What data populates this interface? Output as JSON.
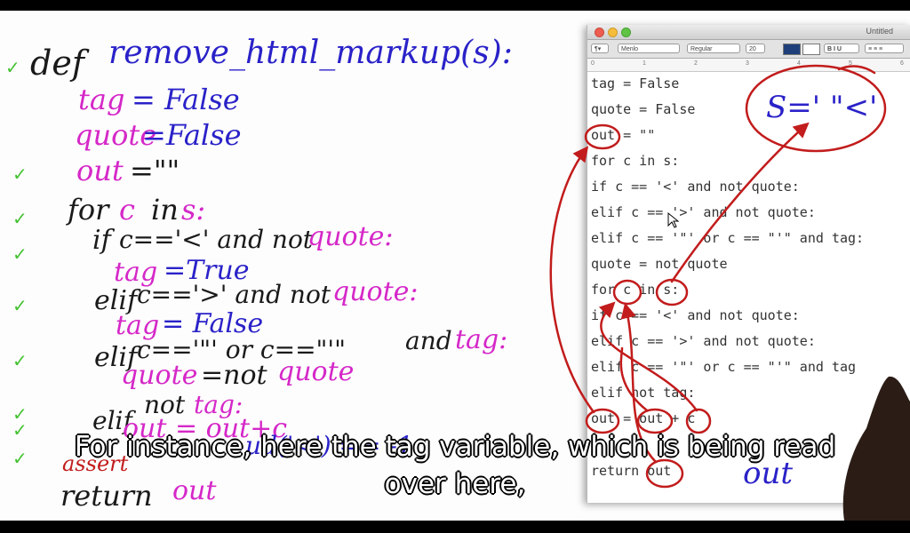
{
  "handwriting": {
    "def_kw": "def",
    "func_sig": "remove_html_markup(s):",
    "tag_name": "tag",
    "tag_init": "= False",
    "quote_name": "quote",
    "quote_init": "=False",
    "out_name": "out",
    "out_init": "=\"\"",
    "for_kw": "for",
    "for_var": "c",
    "for_in": "in",
    "for_iter": "s:",
    "if_kw": "if",
    "if_cond": "c=='<' and not",
    "if_quote": "quote:",
    "if_tag": "tag",
    "if_true": "=True",
    "elif1_kw": "elif",
    "elif1_cond": "c=='>' and not",
    "elif1_quote": "quote:",
    "elif1_tag": "tag",
    "elif1_false": "= False",
    "elif2_kw": "elif",
    "elif2_cond": "c=='\"' or c==\"'\"",
    "elif2_and": "and",
    "elif2_tag": "tag:",
    "quote_assign_a": "quote",
    "quote_assign_b": "=not",
    "quote_assign_c": "quote",
    "elif3_kw": "elif",
    "elif3_cond": "not",
    "elif3_tag": "tag:",
    "out_assign": "out = out+c",
    "assert_word": "assert",
    "return_kw": "return",
    "return_val": "out",
    "board_fragment": "ud('<') == -1",
    "s_note": "S=' \"<'",
    "out_note": "out"
  },
  "editor": {
    "window_title": "Untitled",
    "font_name": "Menlo",
    "font_style": "Regular",
    "font_size": "20",
    "ruler_marks": [
      "0",
      "1",
      "2",
      "3",
      "4",
      "5",
      "6"
    ],
    "code_lines": [
      "tag = False",
      "quote = False",
      "out = \"\"",
      "for c in s:",
      "if c == '<' and not quote:",
      "elif c == '>' and not quote:",
      "elif c == '\"' or c == \"'\" and tag:",
      "quote = not quote",
      "for c in s:",
      "if c == '<' and not quote:",
      "elif c == '>' and not quote:",
      "elif c == '\"' or c == \"'\" and tag",
      "elif not tag:",
      "out = out + c",
      "return out"
    ]
  },
  "subtitle": {
    "line1": "For instance, here the tag variable, which is being read",
    "line2": "over here,"
  },
  "colors": {
    "ink_black": "#1a1a1a",
    "ink_blue": "#2a22c8",
    "ink_pink": "#d528c8",
    "ink_red": "#c21c1c",
    "check_green": "#45c232"
  }
}
